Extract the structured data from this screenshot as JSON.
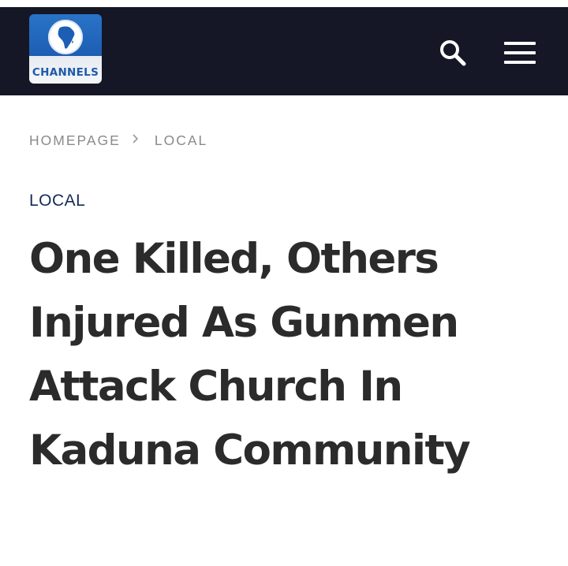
{
  "header": {
    "logo_text": "CHANNELS",
    "search_icon": "search-icon",
    "menu_icon": "hamburger-menu-icon",
    "background_color": "#151726"
  },
  "breadcrumb": {
    "items": [
      "HOMEPAGE",
      "LOCAL"
    ],
    "separator_icon": "chevron-right-icon"
  },
  "article": {
    "category": "LOCAL",
    "headline_lines": [
      "One Killed, Others",
      "Injured As Gunmen",
      "Attack Church In",
      "Kaduna Community"
    ]
  },
  "colors": {
    "category": "#152a55",
    "headline": "#2b2b2b",
    "breadcrumb": "#8a8a8a",
    "logo_blue": "#1e5aa8"
  }
}
